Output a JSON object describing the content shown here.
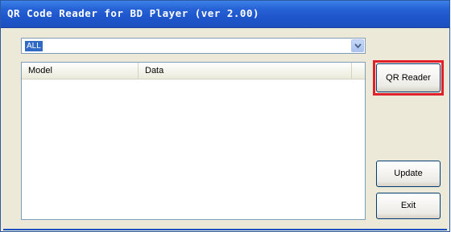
{
  "window": {
    "title": "QR Code Reader for BD Player (ver 2.00)"
  },
  "filter": {
    "selected": "ALL",
    "icon": "chevron-down-icon"
  },
  "list": {
    "columns": [
      "Model",
      "Data"
    ],
    "rows": []
  },
  "buttons": {
    "qr_reader": "QR Reader",
    "update": "Update",
    "exit": "Exit"
  },
  "highlight": {
    "target": "qr-reader-button",
    "color": "#e0202a"
  }
}
